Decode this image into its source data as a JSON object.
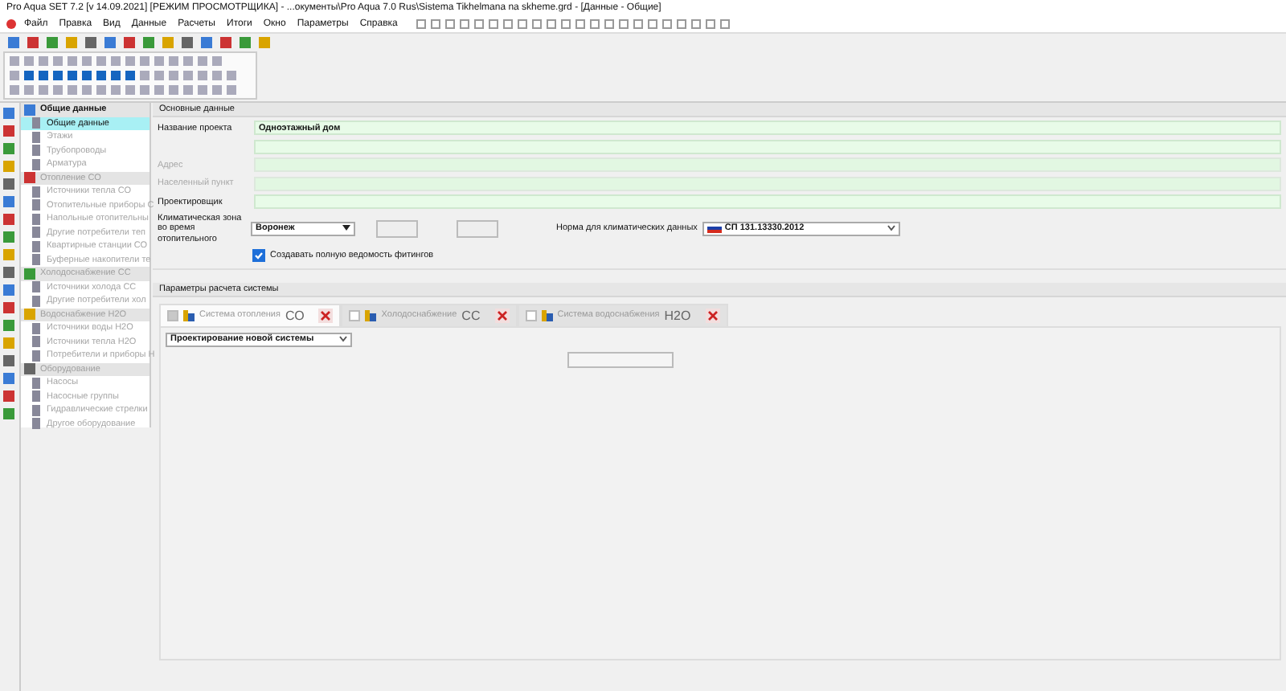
{
  "window": {
    "title": "Pro Aqua SET 7.2  [v 14.09.2021] [РЕЖИМ ПРОСМОТРЩИКА] - ...окументы\\Pro Aqua 7.0 Rus\\Sistema Tikhelmana na skheme.grd - [Данные - Общие]"
  },
  "menu": [
    "Файл",
    "Правка",
    "Вид",
    "Данные",
    "Расчеты",
    "Итоги",
    "Окно",
    "Параметры",
    "Справка"
  ],
  "sidebar": {
    "groups": [
      {
        "label": "Общие данные",
        "disabled": false,
        "children": [
          {
            "label": "Общие данные",
            "selected": true,
            "disabled": false
          },
          {
            "label": "Этажи",
            "selected": false,
            "disabled": true
          },
          {
            "label": "Трубопроводы",
            "selected": false,
            "disabled": true
          },
          {
            "label": "Арматура",
            "selected": false,
            "disabled": true
          }
        ]
      },
      {
        "label": "Отопление СО",
        "disabled": true,
        "children": [
          {
            "label": "Источники тепла СО",
            "selected": false,
            "disabled": true
          },
          {
            "label": "Отопительные приборы С",
            "selected": false,
            "disabled": true
          },
          {
            "label": "Напольные отопительны",
            "selected": false,
            "disabled": true
          },
          {
            "label": "Другие потребители теп",
            "selected": false,
            "disabled": true
          },
          {
            "label": "Квартирные станции СО",
            "selected": false,
            "disabled": true
          },
          {
            "label": "Буферные накопители те",
            "selected": false,
            "disabled": true
          }
        ]
      },
      {
        "label": "Холодоснабжение СС",
        "disabled": true,
        "children": [
          {
            "label": "Источники холода СС",
            "selected": false,
            "disabled": true
          },
          {
            "label": "Другие потребители хол",
            "selected": false,
            "disabled": true
          }
        ]
      },
      {
        "label": "Водоснабжение Н2О",
        "disabled": true,
        "children": [
          {
            "label": "Источники воды Н2О",
            "selected": false,
            "disabled": true
          },
          {
            "label": "Источники тепла Н2О",
            "selected": false,
            "disabled": true
          },
          {
            "label": "Потребители и приборы Н",
            "selected": false,
            "disabled": true
          }
        ]
      },
      {
        "label": "Оборудование",
        "disabled": true,
        "children": [
          {
            "label": "Насосы",
            "selected": false,
            "disabled": true
          },
          {
            "label": "Насосные группы",
            "selected": false,
            "disabled": true
          },
          {
            "label": "Гидравлические стрелки",
            "selected": false,
            "disabled": true
          },
          {
            "label": "Другое оборудование",
            "selected": false,
            "disabled": true
          }
        ]
      }
    ]
  },
  "general": {
    "title": "Основные данные",
    "fields": [
      {
        "label": "Название проекта",
        "value": "Одноэтажный дом",
        "disabled": false
      },
      {
        "disabled": false
      },
      {
        "label": "Адрес",
        "disabled": true
      },
      {
        "label": "Населенный пункт",
        "disabled": true
      },
      {
        "label": "Проектировщик",
        "disabled": false
      }
    ],
    "climate_label": "Климатическая зона во время отопительного",
    "city": "Воронеж",
    "norm_label": "Норма для климатических данных",
    "norm": "СП 131.13330.2012",
    "fittings": {
      "label": "Создавать полную ведомость фитингов",
      "checked": true
    }
  },
  "params": {
    "title": "Параметры расчета системы",
    "tabs": [
      {
        "label": "Система отопления",
        "code": "СО",
        "checked": true,
        "selected": true
      },
      {
        "label": "Холодоснабжение",
        "code": "СС",
        "checked": false,
        "selected": false
      },
      {
        "label": "Система водоснабжения",
        "code": "Н2О",
        "checked": false,
        "selected": false
      }
    ],
    "mode": "Проектирование новой системы"
  }
}
